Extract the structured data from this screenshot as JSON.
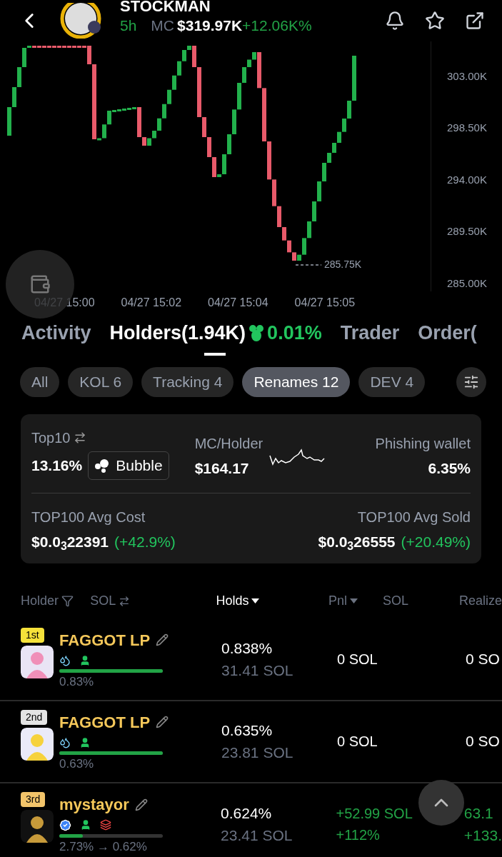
{
  "header": {
    "title": "STOCKMAN",
    "age": "5h",
    "mc_label": "MC",
    "mc_value": "$319.97K",
    "change": "+12.06K%"
  },
  "chart": {
    "price_labels": [
      "303.00K",
      "298.50K",
      "294.00K",
      "289.50K",
      "285.00K"
    ],
    "time_labels": [
      "04/27 15:00",
      "04/27 15:02",
      "04/27 15:04",
      "04/27 15:05"
    ],
    "low_label": "285.75K"
  },
  "tabs": [
    {
      "label": "Activity",
      "selected": false
    },
    {
      "label": "Holders(1.94K)",
      "selected": true,
      "badge": "0.01%"
    },
    {
      "label": "Trader",
      "selected": false
    },
    {
      "label": "Order(",
      "selected": false
    }
  ],
  "filters": [
    {
      "label": "All",
      "selected": false
    },
    {
      "label": "KOL 6",
      "selected": false
    },
    {
      "label": "Tracking 4",
      "selected": false
    },
    {
      "label": "Renames 12",
      "selected": true
    },
    {
      "label": "DEV 4",
      "selected": false
    }
  ],
  "stats": {
    "top10_label": "Top10",
    "top10_value": "13.16%",
    "bubble": "Bubble",
    "mc_holder_label": "MC/Holder",
    "mc_holder_value": "$164.17",
    "phishing_label": "Phishing wallet",
    "phishing_value": "6.35%",
    "avg_cost_label": "TOP100 Avg Cost",
    "avg_cost_value": "$0.0$_{3}$22391",
    "avg_cost_change": "(+42.9%)",
    "avg_sold_label": "TOP100 Avg Sold",
    "avg_sold_value": "$0.0$_{3}$26555",
    "avg_sold_change": "(+20.49%)"
  },
  "columns": [
    {
      "label": "Holder",
      "kind": "filter"
    },
    {
      "label": "SOL",
      "kind": "convert"
    },
    {
      "label": "Holds",
      "kind": "sort",
      "selected": true
    },
    {
      "label": "Pnl",
      "kind": "sort",
      "selected": false
    },
    {
      "label": "SOL",
      "kind": "plain"
    },
    {
      "label": "Realize",
      "kind": "plain"
    }
  ],
  "rows": [
    {
      "rank": "1st",
      "color": "#f5e13a",
      "name": "FAGGOT LP",
      "tags": [
        {
          "kind": "drops"
        },
        {
          "kind": "person"
        }
      ],
      "level": 1,
      "share": "0.83%",
      "holds_pct": "0.838%",
      "holds_sol": "31.41 SOL",
      "pnl": [
        "0 SOL"
      ],
      "realized": [
        "0 SO"
      ],
      "gain": false
    },
    {
      "rank": "2nd",
      "color": "#e4e4e4",
      "name": "FAGGOT LP",
      "tags": [
        {
          "kind": "drops"
        },
        {
          "kind": "person"
        }
      ],
      "level": 1,
      "share": "0.63%",
      "holds_pct": "0.635%",
      "holds_sol": "23.81 SOL",
      "pnl": [
        "0 SOL"
      ],
      "realized": [
        "0 SO"
      ],
      "gain": false
    },
    {
      "rank": "3rd",
      "color": "#f2c46a",
      "name": "mystayor",
      "tags": [
        {
          "kind": "verified"
        },
        {
          "kind": "person"
        },
        {
          "kind": "layers"
        }
      ],
      "level": 0.23,
      "share": "2.73% → 0.62%",
      "holds_pct": "0.624%",
      "holds_sol": "23.41 SOL",
      "pnl": [
        "+52.99 SOL",
        "+112%"
      ],
      "realized": [
        "63.1",
        "+133."
      ],
      "gain": true
    }
  ]
}
